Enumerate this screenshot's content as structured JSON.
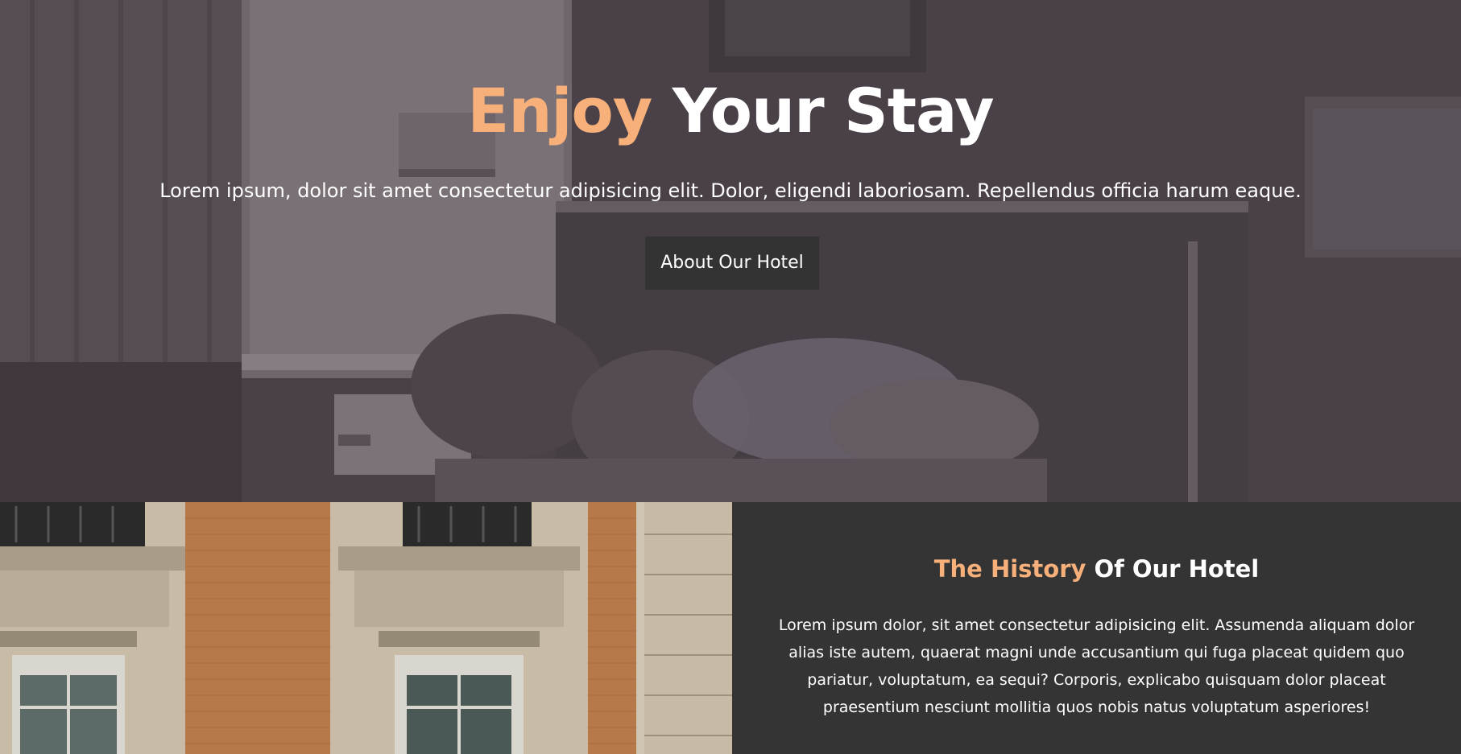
{
  "hero": {
    "title_accent": "Enjoy",
    "title_rest": "Your Stay",
    "subtitle": "Lorem ipsum, dolor sit amet consectetur adipisicing elit. Dolor, eligendi laboriosam. Repellendus officia harum eaque.",
    "button_label": "About Our Hotel",
    "background_image": "hotel-room-bed-photo"
  },
  "history": {
    "title_accent": "The History",
    "title_rest": "Of Our Hotel",
    "text": "Lorem ipsum dolor, sit amet consectetur adipisicing elit. Assumenda aliquam dolor alias iste autem, quaerat magni unde accusantium qui fuga placeat quidem quo pariatur, voluptatum, ea sequi? Corporis, explicabo quisquam dolor placeat praesentium nesciunt mollitia quos nobis natus voluptatum asperiores!",
    "image": "hotel-building-facade-photo"
  },
  "colors": {
    "accent": "#f8b07a",
    "panel": "#343434",
    "button": "#333333",
    "hero_tint": "#4a4249"
  }
}
